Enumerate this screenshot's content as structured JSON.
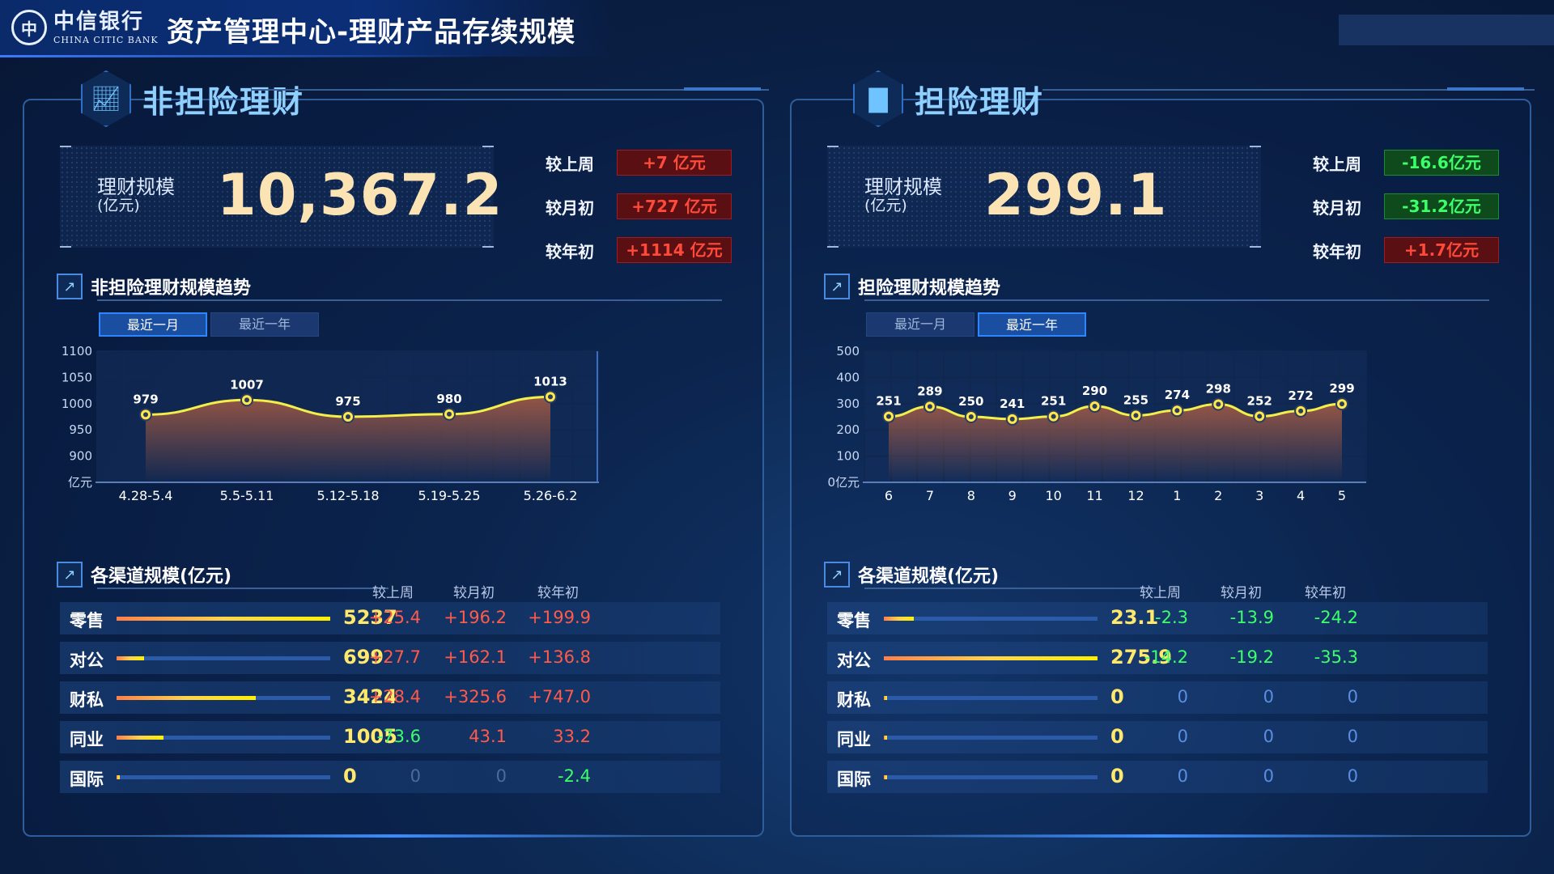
{
  "header": {
    "logo_cn": "中信银行",
    "logo_en": "CHINA CITIC BANK",
    "title": "资产管理中心-理财产品存续规模"
  },
  "left": {
    "name": "非担险理财",
    "total_label": "理财规模",
    "total_unit": "(亿元)",
    "total_value": "10,367.2",
    "deltas": [
      {
        "label": "较上周",
        "value": "+7 亿元",
        "tone": "red"
      },
      {
        "label": "较月初",
        "value": "+727 亿元",
        "tone": "red"
      },
      {
        "label": "较年初",
        "value": "+1114 亿元",
        "tone": "red"
      }
    ],
    "trend_title": "非担险理财规模趋势",
    "tabs": [
      {
        "label": "最近一月",
        "active": true
      },
      {
        "label": "最近一年",
        "active": false
      }
    ],
    "channel_title": "各渠道规模(亿元)",
    "columns": [
      "较上周",
      "较月初",
      "较年初"
    ],
    "channels": [
      {
        "label": "零售",
        "value": "5237",
        "share": 1.0,
        "d": [
          "+25.4",
          "+196.2",
          "+199.9"
        ],
        "tones": [
          "red",
          "red",
          "red"
        ]
      },
      {
        "label": "对公",
        "value": "699",
        "share": 0.13,
        "d": [
          "+27.7",
          "+162.1",
          "+136.8"
        ],
        "tones": [
          "red",
          "red",
          "red"
        ]
      },
      {
        "label": "财私",
        "value": "3424",
        "share": 0.65,
        "d": [
          "+28.4",
          "+325.6",
          "+747.0"
        ],
        "tones": [
          "red",
          "red",
          "red"
        ]
      },
      {
        "label": "同业",
        "value": "1005",
        "share": 0.22,
        "d": [
          "-73.6",
          "43.1",
          "33.2"
        ],
        "tones": [
          "green",
          "red",
          "red"
        ]
      },
      {
        "label": "国际",
        "value": "0",
        "share": 0.0,
        "d": [
          "0",
          "0",
          "-2.4"
        ],
        "tones": [
          "zero",
          "zero",
          "green"
        ]
      }
    ]
  },
  "right": {
    "name": "担险理财",
    "total_label": "理财规模",
    "total_unit": "(亿元)",
    "total_value": "299.1",
    "deltas": [
      {
        "label": "较上周",
        "value": "-16.6亿元",
        "tone": "green"
      },
      {
        "label": "较月初",
        "value": "-31.2亿元",
        "tone": "green"
      },
      {
        "label": "较年初",
        "value": "+1.7亿元",
        "tone": "red"
      }
    ],
    "trend_title": "担险理财规模趋势",
    "tabs": [
      {
        "label": "最近一月",
        "active": false
      },
      {
        "label": "最近一年",
        "active": true
      }
    ],
    "channel_title": "各渠道规模(亿元)",
    "columns": [
      "较上周",
      "较月初",
      "较年初"
    ],
    "channels": [
      {
        "label": "零售",
        "value": "23.1",
        "share": 0.14,
        "d": [
          "-2.3",
          "-13.9",
          "-24.2"
        ],
        "tones": [
          "green",
          "green",
          "green"
        ]
      },
      {
        "label": "对公",
        "value": "275.9",
        "share": 1.0,
        "d": [
          "-14.2",
          "-19.2",
          "-35.3"
        ],
        "tones": [
          "green",
          "green",
          "green"
        ]
      },
      {
        "label": "财私",
        "value": "0",
        "share": 0.0,
        "d": [
          "0",
          "0",
          "0"
        ],
        "tones": [
          "zero-b",
          "zero-b",
          "zero-b"
        ]
      },
      {
        "label": "同业",
        "value": "0",
        "share": 0.0,
        "d": [
          "0",
          "0",
          "0"
        ],
        "tones": [
          "zero-b",
          "zero-b",
          "zero-b"
        ]
      },
      {
        "label": "国际",
        "value": "0",
        "share": 0.0,
        "d": [
          "0",
          "0",
          "0"
        ],
        "tones": [
          "zero-b",
          "zero-b",
          "zero-b"
        ]
      }
    ]
  },
  "chart_data": [
    {
      "type": "line",
      "categories": [
        "4.28-5.4",
        "5.5-5.11",
        "5.12-5.18",
        "5.19-5.25",
        "5.26-6.2"
      ],
      "values": [
        979,
        1007,
        975,
        980,
        1013
      ],
      "ylim": [
        850,
        1100
      ],
      "yticks": [
        "1100",
        "1050",
        "1000",
        "950",
        "900",
        "亿元"
      ],
      "grid": true
    },
    {
      "type": "line",
      "categories": [
        "6",
        "7",
        "8",
        "9",
        "10",
        "11",
        "12",
        "1",
        "2",
        "3",
        "4",
        "5"
      ],
      "values": [
        251,
        289,
        250,
        241,
        251,
        290,
        255,
        274,
        298,
        252,
        272,
        299
      ],
      "ylim": [
        0,
        500
      ],
      "yticks": [
        "500",
        "400",
        "300",
        "200",
        "100",
        "0亿元"
      ],
      "grid": true
    }
  ]
}
